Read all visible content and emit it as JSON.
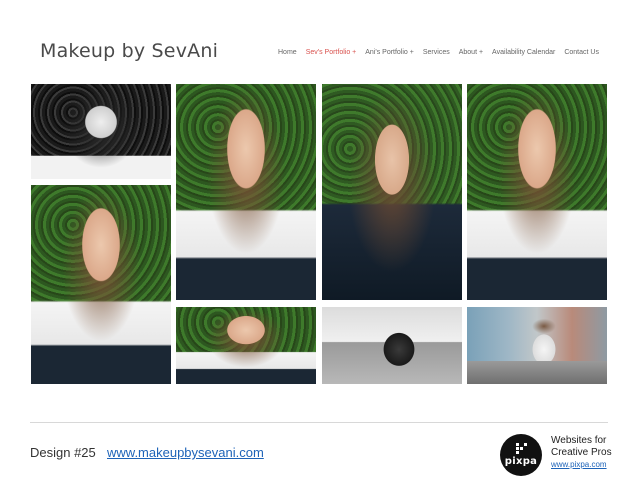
{
  "site": {
    "title": "Makeup by SevAni"
  },
  "nav": {
    "items": [
      {
        "label": "Home"
      },
      {
        "label": "Sev's Portfolio +"
      },
      {
        "label": "Ani's Portfolio +"
      },
      {
        "label": "Services"
      },
      {
        "label": "About +"
      },
      {
        "label": "Availability Calendar"
      },
      {
        "label": "Contact Us"
      }
    ],
    "active_color": "#d9534f"
  },
  "footer": {
    "design_label": "Design #25",
    "design_link": "www.makeupbysevani.com",
    "pixpa_logo_text": "pixpa",
    "pixpa_tagline_line1": "Websites for",
    "pixpa_tagline_line2": "Creative Pros",
    "pixpa_url": "www.pixpa.com"
  }
}
